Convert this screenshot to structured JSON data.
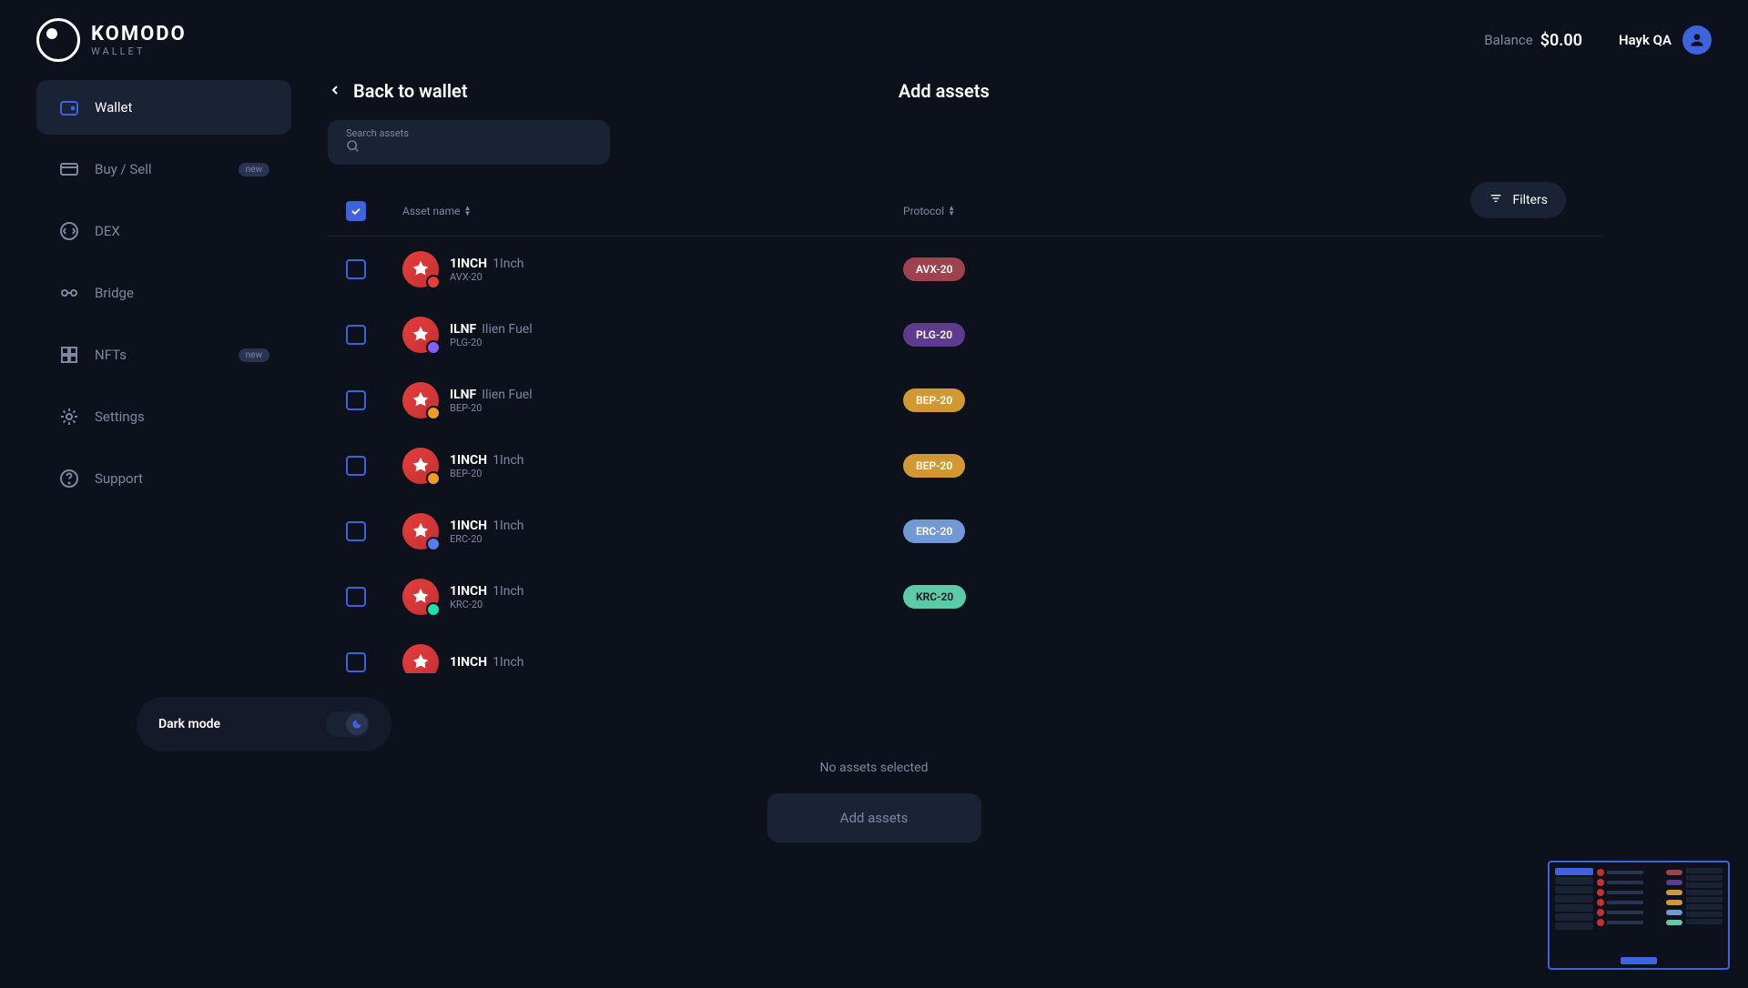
{
  "logo": {
    "main": "KOMODO",
    "sub": "WALLET"
  },
  "header": {
    "balance_label": "Balance",
    "balance_value": "$0.00",
    "user_name": "Hayk QA"
  },
  "sidebar": {
    "items": [
      {
        "label": "Wallet",
        "active": true
      },
      {
        "label": "Buy / Sell",
        "badge": "new"
      },
      {
        "label": "DEX"
      },
      {
        "label": "Bridge"
      },
      {
        "label": "NFTs",
        "badge": "new"
      },
      {
        "label": "Settings"
      },
      {
        "label": "Support"
      }
    ],
    "dark_mode_label": "Dark mode"
  },
  "main": {
    "back_label": "Back to wallet",
    "page_title": "Add assets",
    "search_label": "Search assets",
    "filters_label": "Filters",
    "col_asset": "Asset name",
    "col_protocol": "Protocol",
    "assets": [
      {
        "symbol": "1INCH",
        "name": "1Inch",
        "subproto": "AVX-20",
        "protocol": "AVX-20",
        "protoClass": "proto-avx",
        "badge": "badge-red"
      },
      {
        "symbol": "ILNF",
        "name": "Ilien Fuel",
        "subproto": "PLG-20",
        "protocol": "PLG-20",
        "protoClass": "proto-plg",
        "badge": "badge-purple"
      },
      {
        "symbol": "ILNF",
        "name": "Ilien Fuel",
        "subproto": "BEP-20",
        "protocol": "BEP-20",
        "protoClass": "proto-bep",
        "badge": "badge-yellow"
      },
      {
        "symbol": "1INCH",
        "name": "1Inch",
        "subproto": "BEP-20",
        "protocol": "BEP-20",
        "protoClass": "proto-bep",
        "badge": "badge-yellow"
      },
      {
        "symbol": "1INCH",
        "name": "1Inch",
        "subproto": "ERC-20",
        "protocol": "ERC-20",
        "protoClass": "proto-erc",
        "badge": "badge-blue"
      },
      {
        "symbol": "1INCH",
        "name": "1Inch",
        "subproto": "KRC-20",
        "protocol": "KRC-20",
        "protoClass": "proto-krc",
        "badge": "badge-teal"
      },
      {
        "symbol": "1INCH",
        "name": "1Inch",
        "subproto": "",
        "protocol": "",
        "protoClass": "",
        "badge": ""
      }
    ],
    "no_assets": "No assets selected",
    "add_btn": "Add assets"
  }
}
